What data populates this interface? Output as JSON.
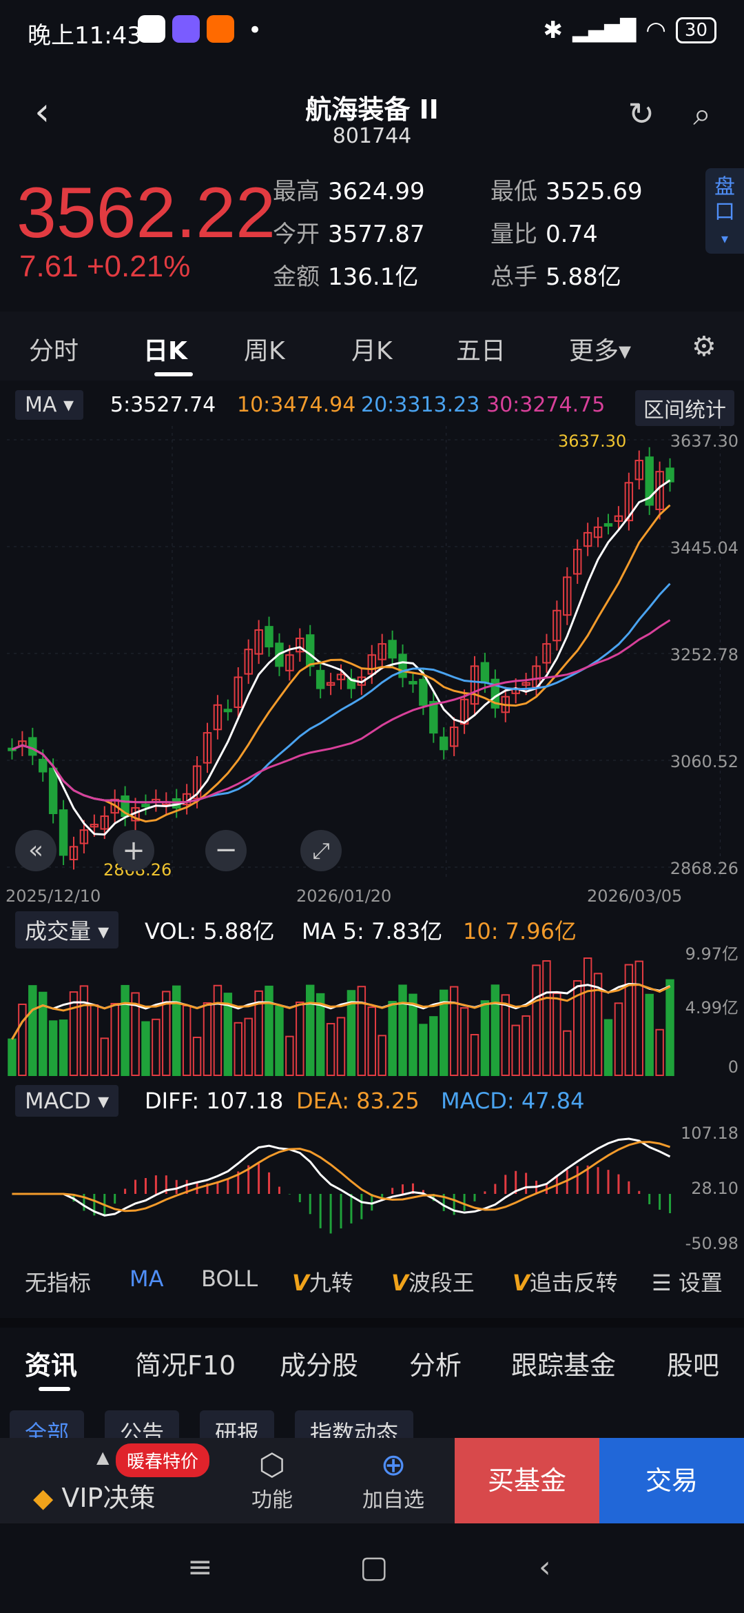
{
  "status": {
    "time": "晚上11:43",
    "battery": "30",
    "dot": "•"
  },
  "header": {
    "title": "航海装备 II",
    "code": "801744"
  },
  "quote": {
    "price": "3562.22",
    "change": "7.61  +0.21%",
    "stats": [
      {
        "k": "最高",
        "v": "3624.99"
      },
      {
        "k": "最低",
        "v": "3525.69"
      },
      {
        "k": "今开",
        "v": "3577.87"
      },
      {
        "k": "量比",
        "v": "0.74"
      },
      {
        "k": "金额",
        "v": "136.1亿"
      },
      {
        "k": "总手",
        "v": "5.88亿"
      }
    ],
    "pankou": "盘\n口"
  },
  "tabs": [
    "分时",
    "日K",
    "周K",
    "月K",
    "五日",
    "更多▾"
  ],
  "ma_bar": {
    "dropdown": "MA ▾",
    "ma5": "5:3527.74",
    "ma10": "10:3474.94",
    "ma20": "20:3313.23",
    "ma30": "30:3274.75",
    "range_stat": "区间统计"
  },
  "chart_data": [
    {
      "type": "candlestick",
      "title": "",
      "x_labels": [
        "2025/12/10",
        "2026/01/20",
        "2026/03/05"
      ],
      "y_ticks": [
        "3637.30",
        "3445.04",
        "3252.78",
        "3060.52",
        "2868.26"
      ],
      "annotations": {
        "high": "3637.30",
        "low": "2868.26"
      },
      "ylim": [
        2868.26,
        3637.3
      ],
      "candles_close_approx": [
        3080,
        3095,
        3070,
        3040,
        2965,
        2890,
        2905,
        2935,
        2945,
        2960,
        2990,
        2960,
        2975,
        2980,
        2990,
        2985,
        2975,
        3000,
        3050,
        3110,
        3160,
        3150,
        3210,
        3260,
        3295,
        3265,
        3230,
        3250,
        3280,
        3230,
        3190,
        3200,
        3215,
        3190,
        3210,
        3250,
        3270,
        3245,
        3210,
        3200,
        3160,
        3110,
        3080,
        3120,
        3170,
        3230,
        3200,
        3155,
        3175,
        3190,
        3200,
        3230,
        3270,
        3330,
        3390,
        3440,
        3470,
        3480,
        3485,
        3500,
        3560,
        3600,
        3520,
        3580,
        3562
      ],
      "ma": {
        "ma5_last": 3527.74,
        "ma10_last": 3474.94,
        "ma20_last": 3313.23,
        "ma30_last": 3274.75
      }
    },
    {
      "type": "bar",
      "title": "成交量",
      "y_ticks": [
        "9.97亿",
        "4.99亿",
        "0"
      ],
      "labels": {
        "vol": "VOL:  5.88亿",
        "ma5": "MA 5:  7.83亿",
        "ma10": "10:  7.96亿"
      }
    },
    {
      "type": "macd",
      "title": "MACD",
      "y_ticks": [
        "107.18",
        "28.10",
        "-50.98"
      ],
      "labels": {
        "diff": "DIFF:  107.18",
        "dea": "DEA:  83.25",
        "macd": "MACD:  47.84"
      }
    }
  ],
  "vol_dropdown": "成交量 ▾",
  "macd_dropdown": "MACD ▾",
  "indicators": [
    "无指标",
    "MA",
    "BOLL",
    "九转",
    "波段王",
    "追击反转",
    "设置"
  ],
  "sections": [
    "资讯",
    "简况F10",
    "成分股",
    "分析",
    "跟踪基金",
    "股吧"
  ],
  "sub_tabs": [
    "全部",
    "公告",
    "研报",
    "指数动态"
  ],
  "bottom": {
    "vip": "VIP决策",
    "badge": "暖春特价",
    "func": "功能",
    "add": "加自选",
    "buy": "买基金",
    "trade": "交易"
  },
  "colors": {
    "up": "#e23b41",
    "down": "#1fa23a",
    "ma5": "#ffffff",
    "ma10": "#f39b2b",
    "ma20": "#4aa3f0",
    "ma30": "#d8409a"
  }
}
